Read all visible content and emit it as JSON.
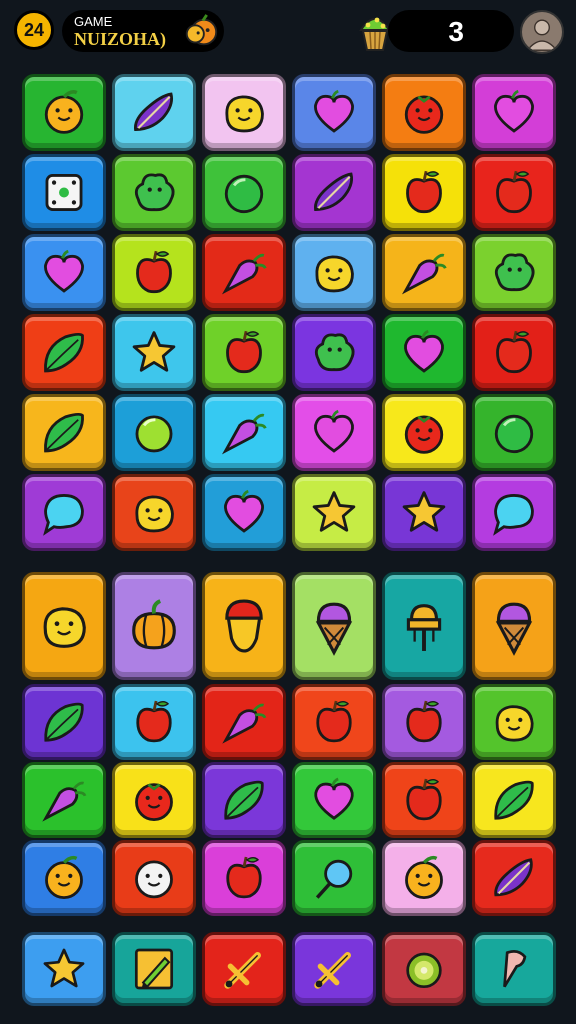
{
  "header": {
    "level": "24",
    "title_small": "GAME",
    "title_big": "NUIZOHA)",
    "score": "3",
    "title_icon": "fruit-bunch-icon",
    "score_icon": "cupcake-icon",
    "avatar_icon": "user-avatar-icon"
  },
  "colors": {
    "background": "#10161d",
    "badge": "#f5b400",
    "title_text": "#f3d046"
  },
  "board": {
    "rows": [
      [
        {
          "color": "#27b531",
          "icon": "orange"
        },
        {
          "color": "#5fd2ee",
          "icon": "eggplant"
        },
        {
          "color": "#f2c4f0",
          "icon": "lemon"
        },
        {
          "color": "#5a86e8",
          "icon": "heart"
        },
        {
          "color": "#f47d12",
          "icon": "tomato"
        },
        {
          "color": "#d33ed7",
          "icon": "heart"
        }
      ],
      [
        {
          "color": "#1f8de6",
          "icon": "dice"
        },
        {
          "color": "#5cc930",
          "icon": "blob"
        },
        {
          "color": "#3fc23a",
          "icon": "ball"
        },
        {
          "color": "#a435d1",
          "icon": "eggplant"
        },
        {
          "color": "#f5e109",
          "icon": "apple"
        },
        {
          "color": "#e8241c",
          "icon": "apple"
        }
      ],
      [
        {
          "color": "#3a91f0",
          "icon": "heart"
        },
        {
          "color": "#b5e31d",
          "icon": "apple"
        },
        {
          "color": "#e32a18",
          "icon": "carrot"
        },
        {
          "color": "#5fb1ef",
          "icon": "lemon"
        },
        {
          "color": "#f5b41a",
          "icon": "carrot"
        },
        {
          "color": "#7bd12e",
          "icon": "blob"
        }
      ],
      [
        {
          "color": "#ef3e16",
          "icon": "leaf"
        },
        {
          "color": "#3ec6ec",
          "icon": "star"
        },
        {
          "color": "#6fd129",
          "icon": "apple"
        },
        {
          "color": "#7b35e0",
          "icon": "blob"
        },
        {
          "color": "#1fb82f",
          "icon": "heart"
        },
        {
          "color": "#e22018",
          "icon": "apple"
        }
      ],
      [
        {
          "color": "#f7b61c",
          "icon": "leaf"
        },
        {
          "color": "#1d9fd8",
          "icon": "lime"
        },
        {
          "color": "#36c9f2",
          "icon": "carrot"
        },
        {
          "color": "#e34ee8",
          "icon": "heart"
        },
        {
          "color": "#f7e81b",
          "icon": "tomato"
        },
        {
          "color": "#35b42c",
          "icon": "ball"
        }
      ],
      [
        {
          "color": "#9f3bd6",
          "icon": "bubble"
        },
        {
          "color": "#e8441a",
          "icon": "lemon"
        },
        {
          "color": "#229ed8",
          "icon": "heart"
        },
        {
          "color": "#c6ec45",
          "icon": "star"
        },
        {
          "color": "#7836d6",
          "icon": "star"
        },
        {
          "color": "#b43ce0",
          "icon": "bubble"
        }
      ]
    ],
    "big_row": [
      {
        "color": "#f5a712",
        "icon": "lemon"
      },
      {
        "color": "#ad80e4",
        "icon": "pumpkin"
      },
      {
        "color": "#f7b318",
        "icon": "acorn"
      },
      {
        "color": "#a4e064",
        "icon": "icecream"
      },
      {
        "color": "#17a7a3",
        "icon": "lantern"
      },
      {
        "color": "#f5a218",
        "icon": "icecream"
      }
    ],
    "lower_rows": [
      [
        {
          "color": "#6d34d3",
          "icon": "leaf"
        },
        {
          "color": "#3cc3ee",
          "icon": "apple"
        },
        {
          "color": "#e32518",
          "icon": "carrot"
        },
        {
          "color": "#f0461b",
          "icon": "apple"
        },
        {
          "color": "#a45ae0",
          "icon": "apple"
        },
        {
          "color": "#54c42c",
          "icon": "lemon"
        }
      ],
      [
        {
          "color": "#2bc12c",
          "icon": "carrot"
        },
        {
          "color": "#f8e119",
          "icon": "tomato"
        },
        {
          "color": "#7b37d9",
          "icon": "leaf"
        },
        {
          "color": "#33c83a",
          "icon": "heart"
        },
        {
          "color": "#ef4419",
          "icon": "apple"
        },
        {
          "color": "#f7e61e",
          "icon": "leaf"
        }
      ],
      [
        {
          "color": "#2f7ee5",
          "icon": "orange"
        },
        {
          "color": "#e83c18",
          "icon": "face"
        },
        {
          "color": "#da3fd9",
          "icon": "apple"
        },
        {
          "color": "#2fbf38",
          "icon": "lollipop"
        },
        {
          "color": "#f4b0e9",
          "icon": "orange"
        },
        {
          "color": "#e62a1d",
          "icon": "eggplant"
        }
      ]
    ],
    "tools_row": [
      {
        "color": "#3d9ef0",
        "icon": "star"
      },
      {
        "color": "#17a59a",
        "icon": "pencil"
      },
      {
        "color": "#e3241b",
        "icon": "sword"
      },
      {
        "color": "#7a36db",
        "icon": "sword"
      },
      {
        "color": "#c23842",
        "icon": "kiwi"
      },
      {
        "color": "#17a89c",
        "icon": "cone"
      }
    ]
  }
}
